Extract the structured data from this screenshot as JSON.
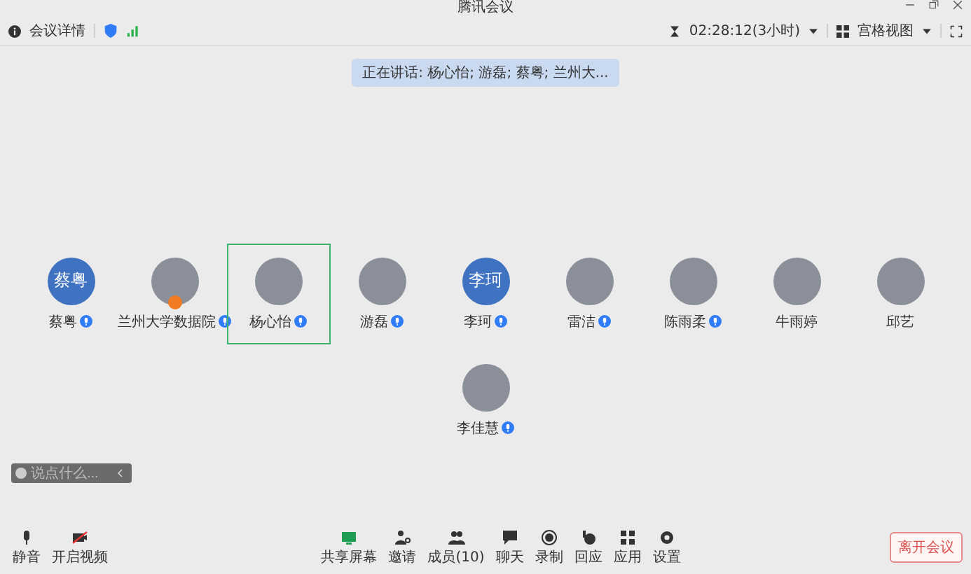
{
  "window": {
    "title": "腾讯会议"
  },
  "toolbar": {
    "info": "会议详情",
    "timer": "02:28:12(3小时)",
    "view": "宫格视图"
  },
  "speaking_banner": "正在讲话: 杨心怡; 游磊; 蔡粤; 兰州大...",
  "participants": [
    {
      "name": "蔡粤",
      "kind": "text",
      "avatar_text": "蔡粤",
      "mic": true,
      "host": false,
      "selected": false
    },
    {
      "name": "兰州大学数据院",
      "kind": "photo",
      "mic": true,
      "host": true,
      "selected": false
    },
    {
      "name": "杨心怡",
      "kind": "photo",
      "mic": true,
      "host": false,
      "selected": true
    },
    {
      "name": "游磊",
      "kind": "photo",
      "mic": true,
      "host": false,
      "selected": false
    },
    {
      "name": "李珂",
      "kind": "text",
      "avatar_text": "李珂",
      "mic": true,
      "host": false,
      "selected": false
    },
    {
      "name": "雷洁",
      "kind": "photo",
      "mic": true,
      "host": false,
      "selected": false
    },
    {
      "name": "陈雨柔",
      "kind": "photo",
      "mic": true,
      "host": false,
      "selected": false
    },
    {
      "name": "牛雨婷",
      "kind": "photo",
      "mic": false,
      "host": false,
      "selected": false
    },
    {
      "name": "邱艺",
      "kind": "photo",
      "mic": false,
      "host": false,
      "selected": false
    },
    {
      "name": "李佳慧",
      "kind": "photo",
      "mic": true,
      "host": false,
      "selected": false
    }
  ],
  "chat": {
    "placeholder": "说点什么..."
  },
  "bottom_left": [
    {
      "kind": "mic",
      "label": "静音"
    },
    {
      "kind": "video",
      "label": "开启视频"
    }
  ],
  "bottom_center": [
    {
      "kind": "share",
      "label": "共享屏幕"
    },
    {
      "kind": "invite",
      "label": "邀请"
    },
    {
      "kind": "members",
      "label": "成员(10)"
    },
    {
      "kind": "chat",
      "label": "聊天"
    },
    {
      "kind": "record",
      "label": "录制"
    },
    {
      "kind": "react",
      "label": "回应"
    },
    {
      "kind": "apps",
      "label": "应用"
    },
    {
      "kind": "settings",
      "label": "设置"
    }
  ],
  "leave_button": "离开会议"
}
